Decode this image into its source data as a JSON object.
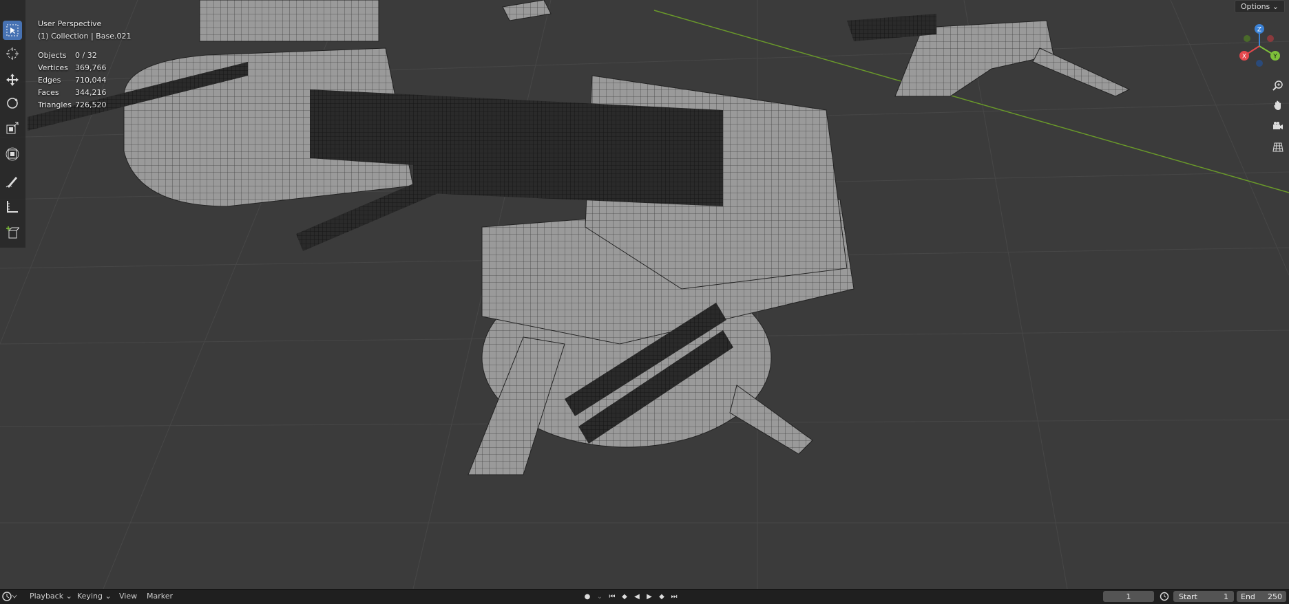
{
  "viewport": {
    "view_name": "User Perspective",
    "collection": "(1) Collection | Base.021",
    "stats": [
      {
        "label": "Objects",
        "value": "0 / 32"
      },
      {
        "label": "Vertices",
        "value": "369,766"
      },
      {
        "label": "Edges",
        "value": "710,044"
      },
      {
        "label": "Faces",
        "value": "344,216"
      },
      {
        "label": "Triangles",
        "value": "726,520"
      }
    ],
    "options_label": "Options",
    "gizmo": {
      "x": "X",
      "y": "Y",
      "z": "Z"
    }
  },
  "toolbar": {
    "tools": [
      "select-box-icon",
      "cursor-icon",
      "move-icon",
      "rotate-icon",
      "scale-icon",
      "transform-icon",
      "annotate-icon",
      "measure-icon",
      "add-cube-icon"
    ]
  },
  "nav_icons": [
    "zoom-icon",
    "pan-hand-icon",
    "camera-icon",
    "grid-ortho-icon"
  ],
  "timeline": {
    "playback": "Playback",
    "keying": "Keying",
    "view": "View",
    "marker": "Marker",
    "current_frame": "1",
    "start_label": "Start",
    "start_value": "1",
    "end_label": "End",
    "end_value": "250"
  },
  "colors": {
    "accent": "#4772b3",
    "axis_x": "#e5484d",
    "axis_y": "#7ec03a",
    "axis_z": "#3b82d6"
  }
}
